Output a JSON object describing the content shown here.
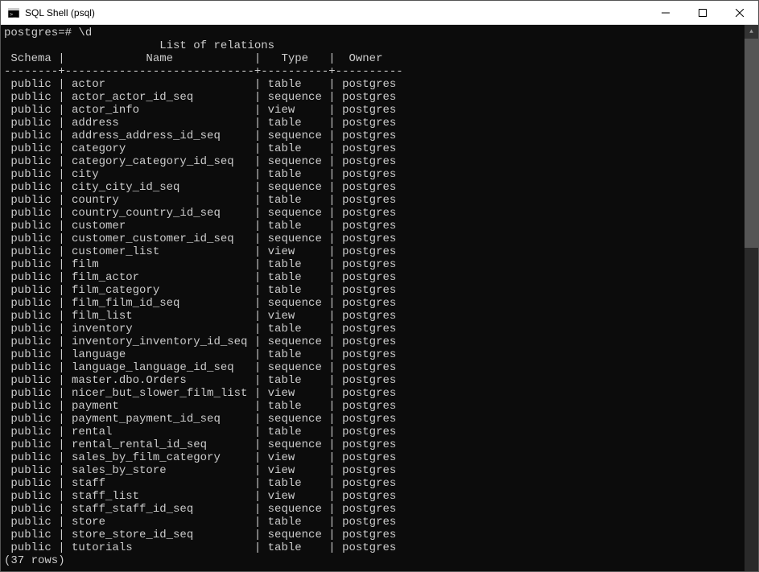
{
  "window": {
    "title": "SQL Shell (psql)"
  },
  "terminal": {
    "prompt": "postgres=# \\d",
    "list_title": "List of relations",
    "columns": {
      "schema": "Schema",
      "name": "Name",
      "type": "Type",
      "owner": "Owner"
    },
    "rows": [
      {
        "schema": "public",
        "name": "actor",
        "type": "table",
        "owner": "postgres"
      },
      {
        "schema": "public",
        "name": "actor_actor_id_seq",
        "type": "sequence",
        "owner": "postgres"
      },
      {
        "schema": "public",
        "name": "actor_info",
        "type": "view",
        "owner": "postgres"
      },
      {
        "schema": "public",
        "name": "address",
        "type": "table",
        "owner": "postgres"
      },
      {
        "schema": "public",
        "name": "address_address_id_seq",
        "type": "sequence",
        "owner": "postgres"
      },
      {
        "schema": "public",
        "name": "category",
        "type": "table",
        "owner": "postgres"
      },
      {
        "schema": "public",
        "name": "category_category_id_seq",
        "type": "sequence",
        "owner": "postgres"
      },
      {
        "schema": "public",
        "name": "city",
        "type": "table",
        "owner": "postgres"
      },
      {
        "schema": "public",
        "name": "city_city_id_seq",
        "type": "sequence",
        "owner": "postgres"
      },
      {
        "schema": "public",
        "name": "country",
        "type": "table",
        "owner": "postgres"
      },
      {
        "schema": "public",
        "name": "country_country_id_seq",
        "type": "sequence",
        "owner": "postgres"
      },
      {
        "schema": "public",
        "name": "customer",
        "type": "table",
        "owner": "postgres"
      },
      {
        "schema": "public",
        "name": "customer_customer_id_seq",
        "type": "sequence",
        "owner": "postgres"
      },
      {
        "schema": "public",
        "name": "customer_list",
        "type": "view",
        "owner": "postgres"
      },
      {
        "schema": "public",
        "name": "film",
        "type": "table",
        "owner": "postgres"
      },
      {
        "schema": "public",
        "name": "film_actor",
        "type": "table",
        "owner": "postgres"
      },
      {
        "schema": "public",
        "name": "film_category",
        "type": "table",
        "owner": "postgres"
      },
      {
        "schema": "public",
        "name": "film_film_id_seq",
        "type": "sequence",
        "owner": "postgres"
      },
      {
        "schema": "public",
        "name": "film_list",
        "type": "view",
        "owner": "postgres"
      },
      {
        "schema": "public",
        "name": "inventory",
        "type": "table",
        "owner": "postgres"
      },
      {
        "schema": "public",
        "name": "inventory_inventory_id_seq",
        "type": "sequence",
        "owner": "postgres"
      },
      {
        "schema": "public",
        "name": "language",
        "type": "table",
        "owner": "postgres"
      },
      {
        "schema": "public",
        "name": "language_language_id_seq",
        "type": "sequence",
        "owner": "postgres"
      },
      {
        "schema": "public",
        "name": "master.dbo.Orders",
        "type": "table",
        "owner": "postgres"
      },
      {
        "schema": "public",
        "name": "nicer_but_slower_film_list",
        "type": "view",
        "owner": "postgres"
      },
      {
        "schema": "public",
        "name": "payment",
        "type": "table",
        "owner": "postgres"
      },
      {
        "schema": "public",
        "name": "payment_payment_id_seq",
        "type": "sequence",
        "owner": "postgres"
      },
      {
        "schema": "public",
        "name": "rental",
        "type": "table",
        "owner": "postgres"
      },
      {
        "schema": "public",
        "name": "rental_rental_id_seq",
        "type": "sequence",
        "owner": "postgres"
      },
      {
        "schema": "public",
        "name": "sales_by_film_category",
        "type": "view",
        "owner": "postgres"
      },
      {
        "schema": "public",
        "name": "sales_by_store",
        "type": "view",
        "owner": "postgres"
      },
      {
        "schema": "public",
        "name": "staff",
        "type": "table",
        "owner": "postgres"
      },
      {
        "schema": "public",
        "name": "staff_list",
        "type": "view",
        "owner": "postgres"
      },
      {
        "schema": "public",
        "name": "staff_staff_id_seq",
        "type": "sequence",
        "owner": "postgres"
      },
      {
        "schema": "public",
        "name": "store",
        "type": "table",
        "owner": "postgres"
      },
      {
        "schema": "public",
        "name": "store_store_id_seq",
        "type": "sequence",
        "owner": "postgres"
      },
      {
        "schema": "public",
        "name": "tutorials",
        "type": "table",
        "owner": "postgres"
      }
    ],
    "row_count_text": "(37 rows)",
    "col_widths": {
      "schema": 8,
      "name": 28,
      "type": 10,
      "owner": 10
    }
  }
}
